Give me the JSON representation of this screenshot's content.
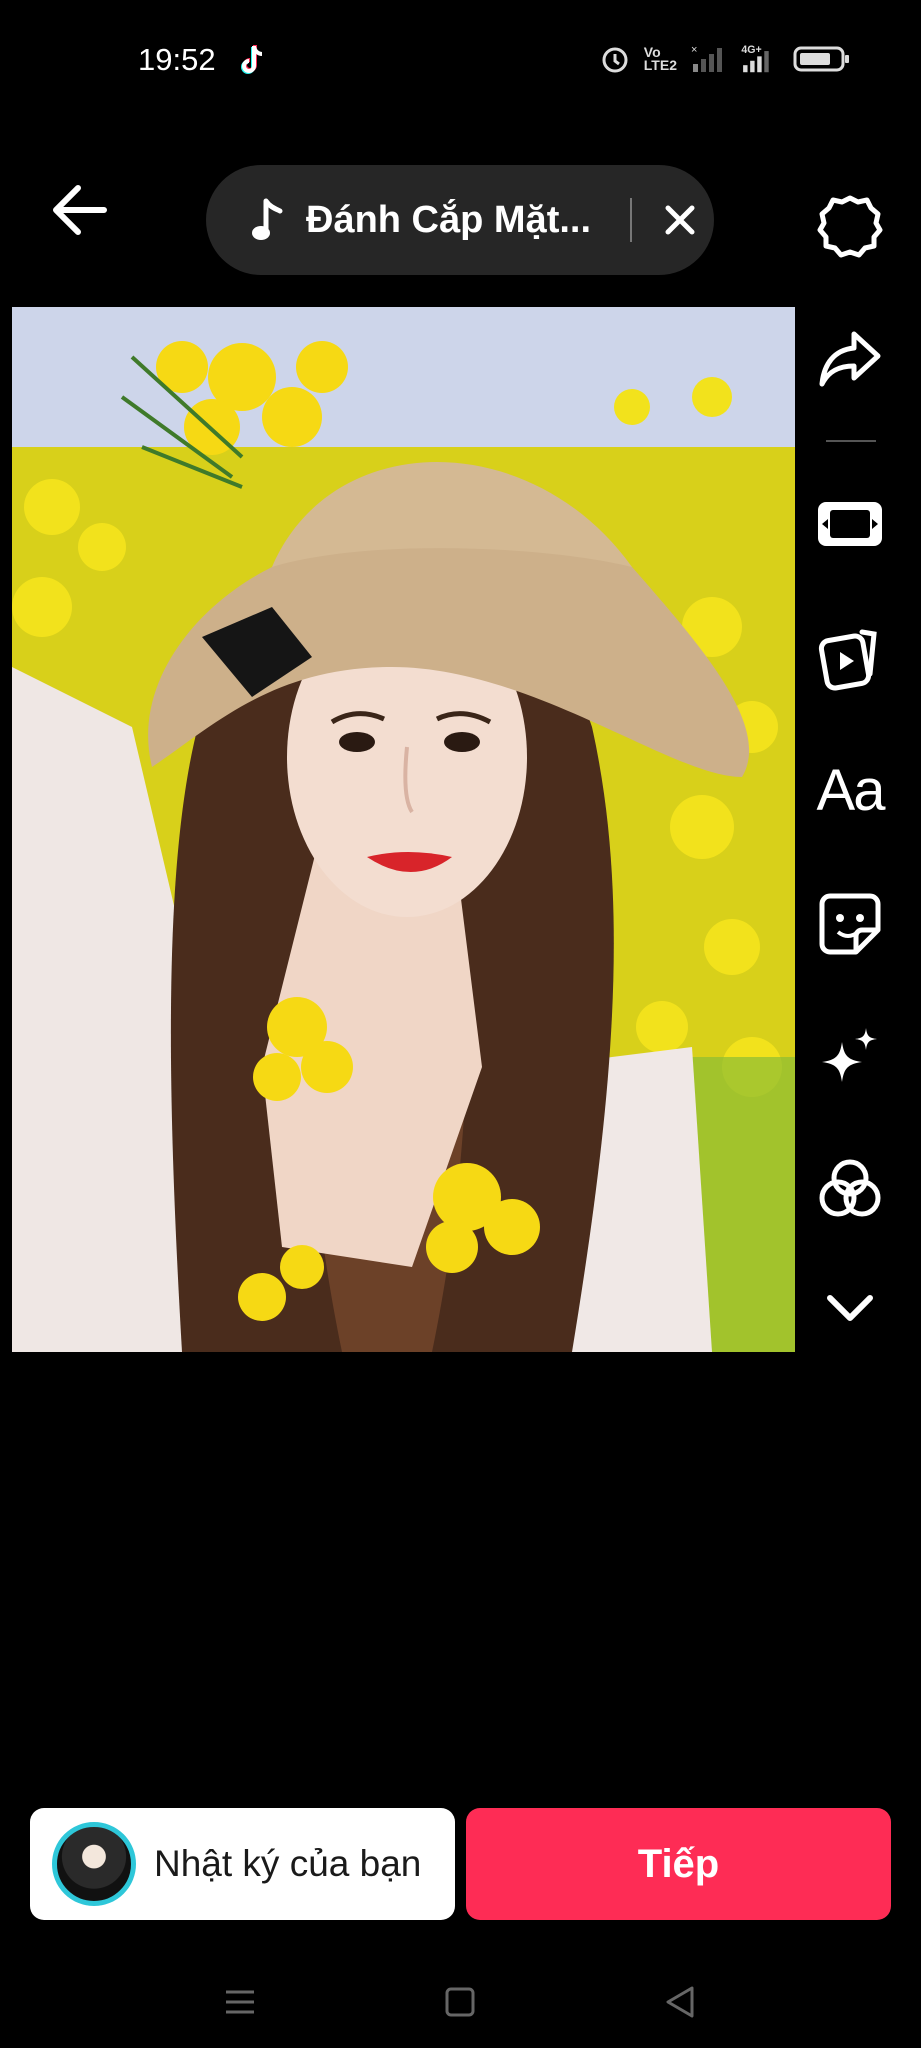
{
  "status_bar": {
    "time": "19:52",
    "icons": [
      "tiktok-icon",
      "alarm-icon",
      "volte-icon",
      "signal-1-icon",
      "signal-4g-icon",
      "battery-icon"
    ],
    "volte_text": "Vo\nLTE2",
    "network_text": "4G"
  },
  "top_bar": {
    "back_icon": "arrow-left-icon",
    "music_title": "Đánh Cắp Mặt...",
    "music_icon": "music-note-icon",
    "close_icon": "close-icon",
    "settings_icon": "settings-icon"
  },
  "toolbar": {
    "items": [
      {
        "icon": "settings-icon"
      },
      {
        "icon": "share-arrow-icon"
      },
      {
        "icon": "aspect-ratio-icon"
      },
      {
        "icon": "template-icon"
      },
      {
        "icon": "text-icon",
        "label": "Aa"
      },
      {
        "icon": "sticker-icon"
      },
      {
        "icon": "effects-sparkle-icon"
      },
      {
        "icon": "filters-icon"
      },
      {
        "icon": "chevron-down-icon"
      }
    ]
  },
  "bottom": {
    "diary_label": "Nhật ký của bạn",
    "next_label": "Tiếp",
    "accent_color": "#fe2c55"
  },
  "nav_bar": {
    "items": [
      "menu-icon",
      "home-square-icon",
      "back-triangle-icon"
    ]
  }
}
